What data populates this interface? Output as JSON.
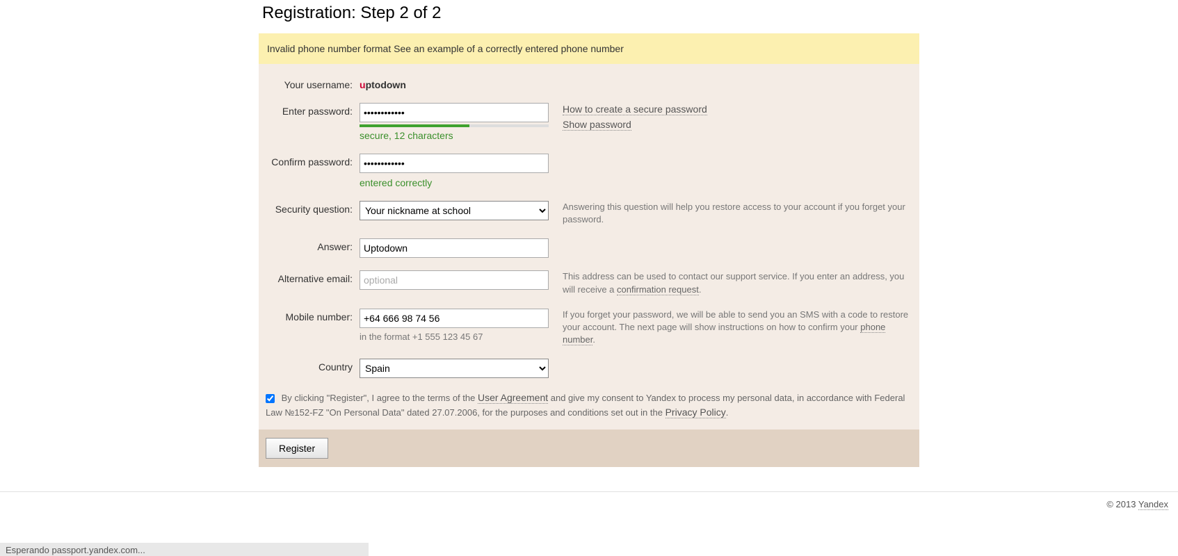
{
  "page_title": "Registration: Step 2 of 2",
  "warning": "Invalid phone number format See an example of a correctly entered phone number",
  "labels": {
    "username": "Your username:",
    "password": "Enter password:",
    "confirm": "Confirm password:",
    "security_q": "Security question:",
    "answer": "Answer:",
    "alt_email": "Alternative email:",
    "mobile": "Mobile number:",
    "country": "Country"
  },
  "values": {
    "username_prefix": "u",
    "username_rest": "ptodown",
    "password": "••••••••••••",
    "confirm": "••••••••••••",
    "security_q": "Your nickname at school",
    "answer": "Uptodown",
    "alt_email": "",
    "alt_email_placeholder": "optional",
    "mobile": "+64 666 98 74 56",
    "country": "Spain"
  },
  "hints": {
    "strength": "secure, 12 characters",
    "confirm_ok": "entered correctly",
    "mobile_format": "in the format +1 555 123 45 67"
  },
  "help": {
    "secure_pw_link": "How to create a secure password",
    "show_pw_link": "Show password",
    "security_q": "Answering this question will help you restore access to your account if you forget your password.",
    "alt_email_pre": "This address can be used to contact our support service. If you enter an address, you will  receive a ",
    "alt_email_link": "confirmation request",
    "alt_email_post": ".",
    "mobile_pre": "If you forget your password, we will be able to send you an SMS with a code to restore your account. The next page will show instructions on how to confirm your ",
    "mobile_link": "phone number",
    "mobile_post": "."
  },
  "agreement": {
    "checked": true,
    "pre": " By clicking \"Register\", I agree to the terms of the ",
    "link1": "User Agreement",
    "mid": " and give my consent to Yandex to  process my personal data, in accordance with Federal Law №152-FZ \"On Personal Data\" dated 27.07.2006, for the purposes and conditions set out in the ",
    "link2": "Privacy Policy",
    "post": "."
  },
  "register_btn": "Register",
  "footer": {
    "copyright": "© 2013 ",
    "brand": "Yandex"
  },
  "status_bar": "Esperando passport.yandex.com..."
}
